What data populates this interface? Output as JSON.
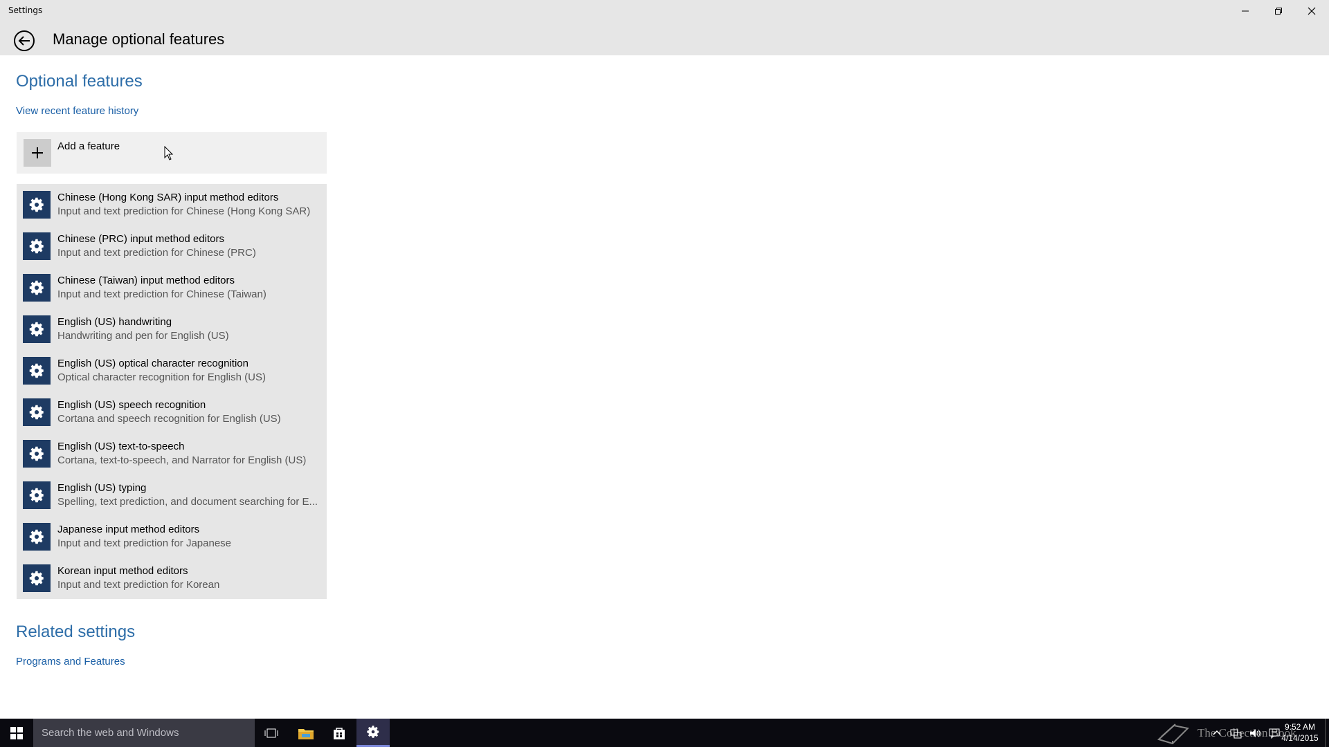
{
  "window": {
    "app_title": "Settings",
    "page_title": "Manage optional features"
  },
  "optional": {
    "heading": "Optional features",
    "history_link": "View recent feature history",
    "add_label": "Add a feature",
    "features": [
      {
        "title": "Chinese (Hong Kong SAR) input method editors",
        "desc": "Input and text prediction for Chinese (Hong Kong SAR)"
      },
      {
        "title": "Chinese (PRC) input method editors",
        "desc": "Input and text prediction for Chinese (PRC)"
      },
      {
        "title": "Chinese (Taiwan) input method editors",
        "desc": "Input and text prediction for Chinese (Taiwan)"
      },
      {
        "title": "English (US) handwriting",
        "desc": "Handwriting and pen for English (US)"
      },
      {
        "title": "English (US) optical character recognition",
        "desc": "Optical character recognition for English (US)"
      },
      {
        "title": "English (US) speech recognition",
        "desc": "Cortana and speech recognition for English (US)"
      },
      {
        "title": "English (US) text-to-speech",
        "desc": "Cortana, text-to-speech, and Narrator for English (US)"
      },
      {
        "title": "English (US) typing",
        "desc": "Spelling, text prediction, and document searching for E..."
      },
      {
        "title": "Japanese input method editors",
        "desc": "Input and text prediction for Japanese"
      },
      {
        "title": "Korean input method editors",
        "desc": "Input and text prediction for Korean"
      }
    ]
  },
  "related": {
    "heading": "Related settings",
    "programs_link": "Programs and Features"
  },
  "taskbar": {
    "search_placeholder": "Search the web and Windows",
    "watermark": "The Collection Book",
    "time": "9:52 AM",
    "date": "4/14/2015"
  },
  "colors": {
    "accent": "#2d6da8",
    "gear_tile": "#1e3b63",
    "header_bg": "#e6e6e6"
  }
}
